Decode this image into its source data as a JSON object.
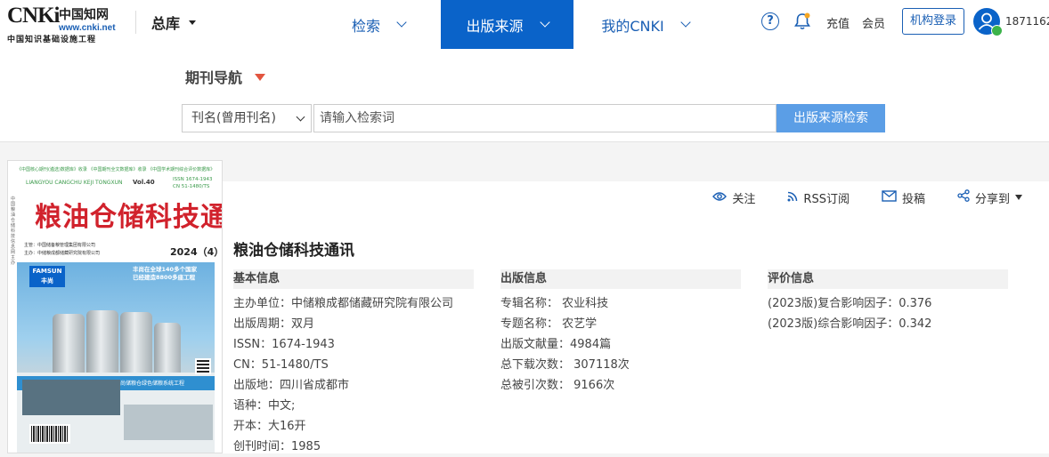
{
  "header": {
    "logo": {
      "mark": "CNKi",
      "cn": "中国知网",
      "url": "www.cnki.net",
      "sub": "中国知识基础设施工程"
    },
    "library": "总库",
    "nav": [
      {
        "label": "检索",
        "active": false
      },
      {
        "label": "出版来源",
        "active": true
      },
      {
        "label": "我的CNKI",
        "active": false
      }
    ],
    "help_icon": "?",
    "topup": "充值",
    "member": "会员",
    "inst_login": "机构登录",
    "username": "1871162"
  },
  "search": {
    "nav_title": "期刊导航",
    "field": "刊名(曾用刊名)",
    "placeholder": "请输入检索词",
    "button": "出版来源检索"
  },
  "cover": {
    "strip": "《中国核心期刊(遴选)数据库》收录 《中国期刊全文数据库》收录 《中国学术期刊综合评价数据库》统计源期刊",
    "pinyin": "LIANGYOU CANGCHU KEJI TONGXUN",
    "vol": "Vol.40",
    "issn_line1": "ISSN 1674-1943",
    "issn_line2": "CN 51-1480/TS",
    "title": "粮油仓储科技通讯",
    "side": "中国粮油仓储科技信息网主办",
    "publisher_line1": "主管：中国储备粮管理集团有限公司",
    "publisher_line2": "主办：中储粮成都储藏研究院有限公司",
    "issue": "2024（4）",
    "famsun": "FAMSUN 丰尚",
    "slogan_line1": "丰尚在全球140多个国家",
    "slogan_line2": "已经建造8800多座工程",
    "band": "丰尚储粮仓绿色储粮系统工程"
  },
  "toolbar": {
    "follow": "关注",
    "rss": "RSS订阅",
    "submit": "投稿",
    "share": "分享到"
  },
  "journal": {
    "title": "粮油仓储科技通讯",
    "basic": {
      "heading": "基本信息",
      "rows": [
        "主办单位：中储粮成都储藏研究院有限公司",
        "出版周期：双月",
        "ISSN：1674-1943",
        "CN：51-1480/TS",
        "出版地：四川省成都市",
        "语种：中文;",
        "开本：大16开",
        "创刊时间：1985"
      ]
    },
    "publish": {
      "heading": "出版信息",
      "rows": [
        "专辑名称：  农业科技",
        "专题名称：  农艺学",
        "出版文献量：4984篇",
        "总下载次数：  307118次",
        "总被引次数：  9166次"
      ]
    },
    "eval": {
      "heading": "评价信息",
      "rows": [
        "(2023版)复合影响因子：0.376",
        "(2023版)综合影响因子：0.342"
      ]
    }
  },
  "colors": {
    "accent": "#0a63c9",
    "link": "#1a5fb4",
    "search_button": "#5b9ee6",
    "nav_marker": "#e2553f",
    "cover_title": "#d1222c"
  }
}
